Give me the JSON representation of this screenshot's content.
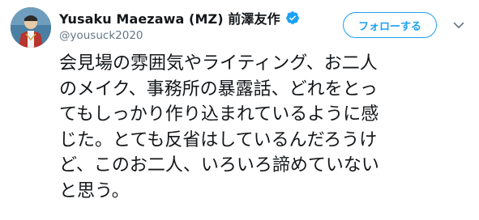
{
  "tweet": {
    "author": {
      "display_name": "Yusaku Maezawa (MZ) 前澤友作",
      "handle": "@yousuck2020",
      "verified": true
    },
    "follow_button_label": "フォローする",
    "text_lines": [
      "会見場の雰囲気やライティング、お二人",
      "のメイク、事務所の暴露話、どれをとっ",
      "てもしっかり作り込まれているように感",
      "じた。とても反省はしているんだろうけ",
      "ど、このお二人、いろいろ諦めていない",
      "と思う。"
    ]
  },
  "icons": {
    "verified": "verified-badge-icon",
    "menu": "chevron-down-icon"
  },
  "colors": {
    "accent": "#1da1f2",
    "text": "#14171a",
    "secondary_text": "#657786"
  }
}
